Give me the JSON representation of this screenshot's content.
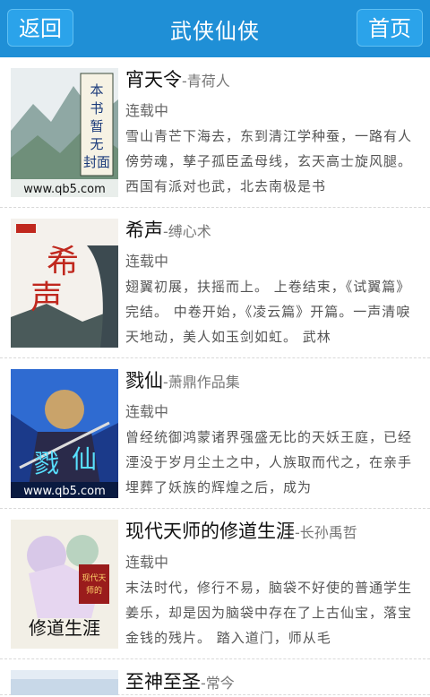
{
  "header": {
    "back_label": "返回",
    "title": "武侠仙侠",
    "home_label": "首页"
  },
  "books": [
    {
      "title": "宵天令",
      "author": "青荷人",
      "status": "连载中",
      "desc": "雪山青芒下海去，东到清江学种蚕，一路有人傍劳魂，孳子孤臣孟母线，玄天高士旋风腿。西国有派对也武，北去南极是书",
      "cover": {
        "text": "本书暂无封面",
        "url_text": "www.qb5.com"
      }
    },
    {
      "title": "希声",
      "author": "缚心术",
      "status": "连载中",
      "desc": "翅翼初展，扶摇而上。 上卷结束，《试翼篇》完结。 中卷开始，《凌云篇》开篇。一声清唳天地动，美人如玉剑如虹。 武林",
      "cover": {
        "text": "希声"
      }
    },
    {
      "title": "戮仙",
      "author": "萧鼎作品集",
      "status": "连载中",
      "desc": "曾经统御鸿蒙诸界强盛无比的天妖王庭，已经湮没于岁月尘土之中，人族取而代之，在亲手埋葬了妖族的辉煌之后，成为",
      "cover": {
        "text": "戮仙",
        "url_text": "www.qb5.com"
      }
    },
    {
      "title": "现代天师的修道生涯",
      "author": "长孙禹哲",
      "status": "连载中",
      "desc": "末法时代，修行不易，脑袋不好使的普通学生姜乐，却是因为脑袋中存在了上古仙宝，落宝金钱的残片。 踏入道门，师从毛",
      "cover": {
        "text": "修道生涯"
      }
    },
    {
      "title": "至神至圣",
      "author": "常今",
      "status": "",
      "desc": "",
      "cover": {
        "text": ""
      }
    }
  ],
  "colors": {
    "header": "#1f8fd6",
    "button": "#2ba3ea"
  }
}
